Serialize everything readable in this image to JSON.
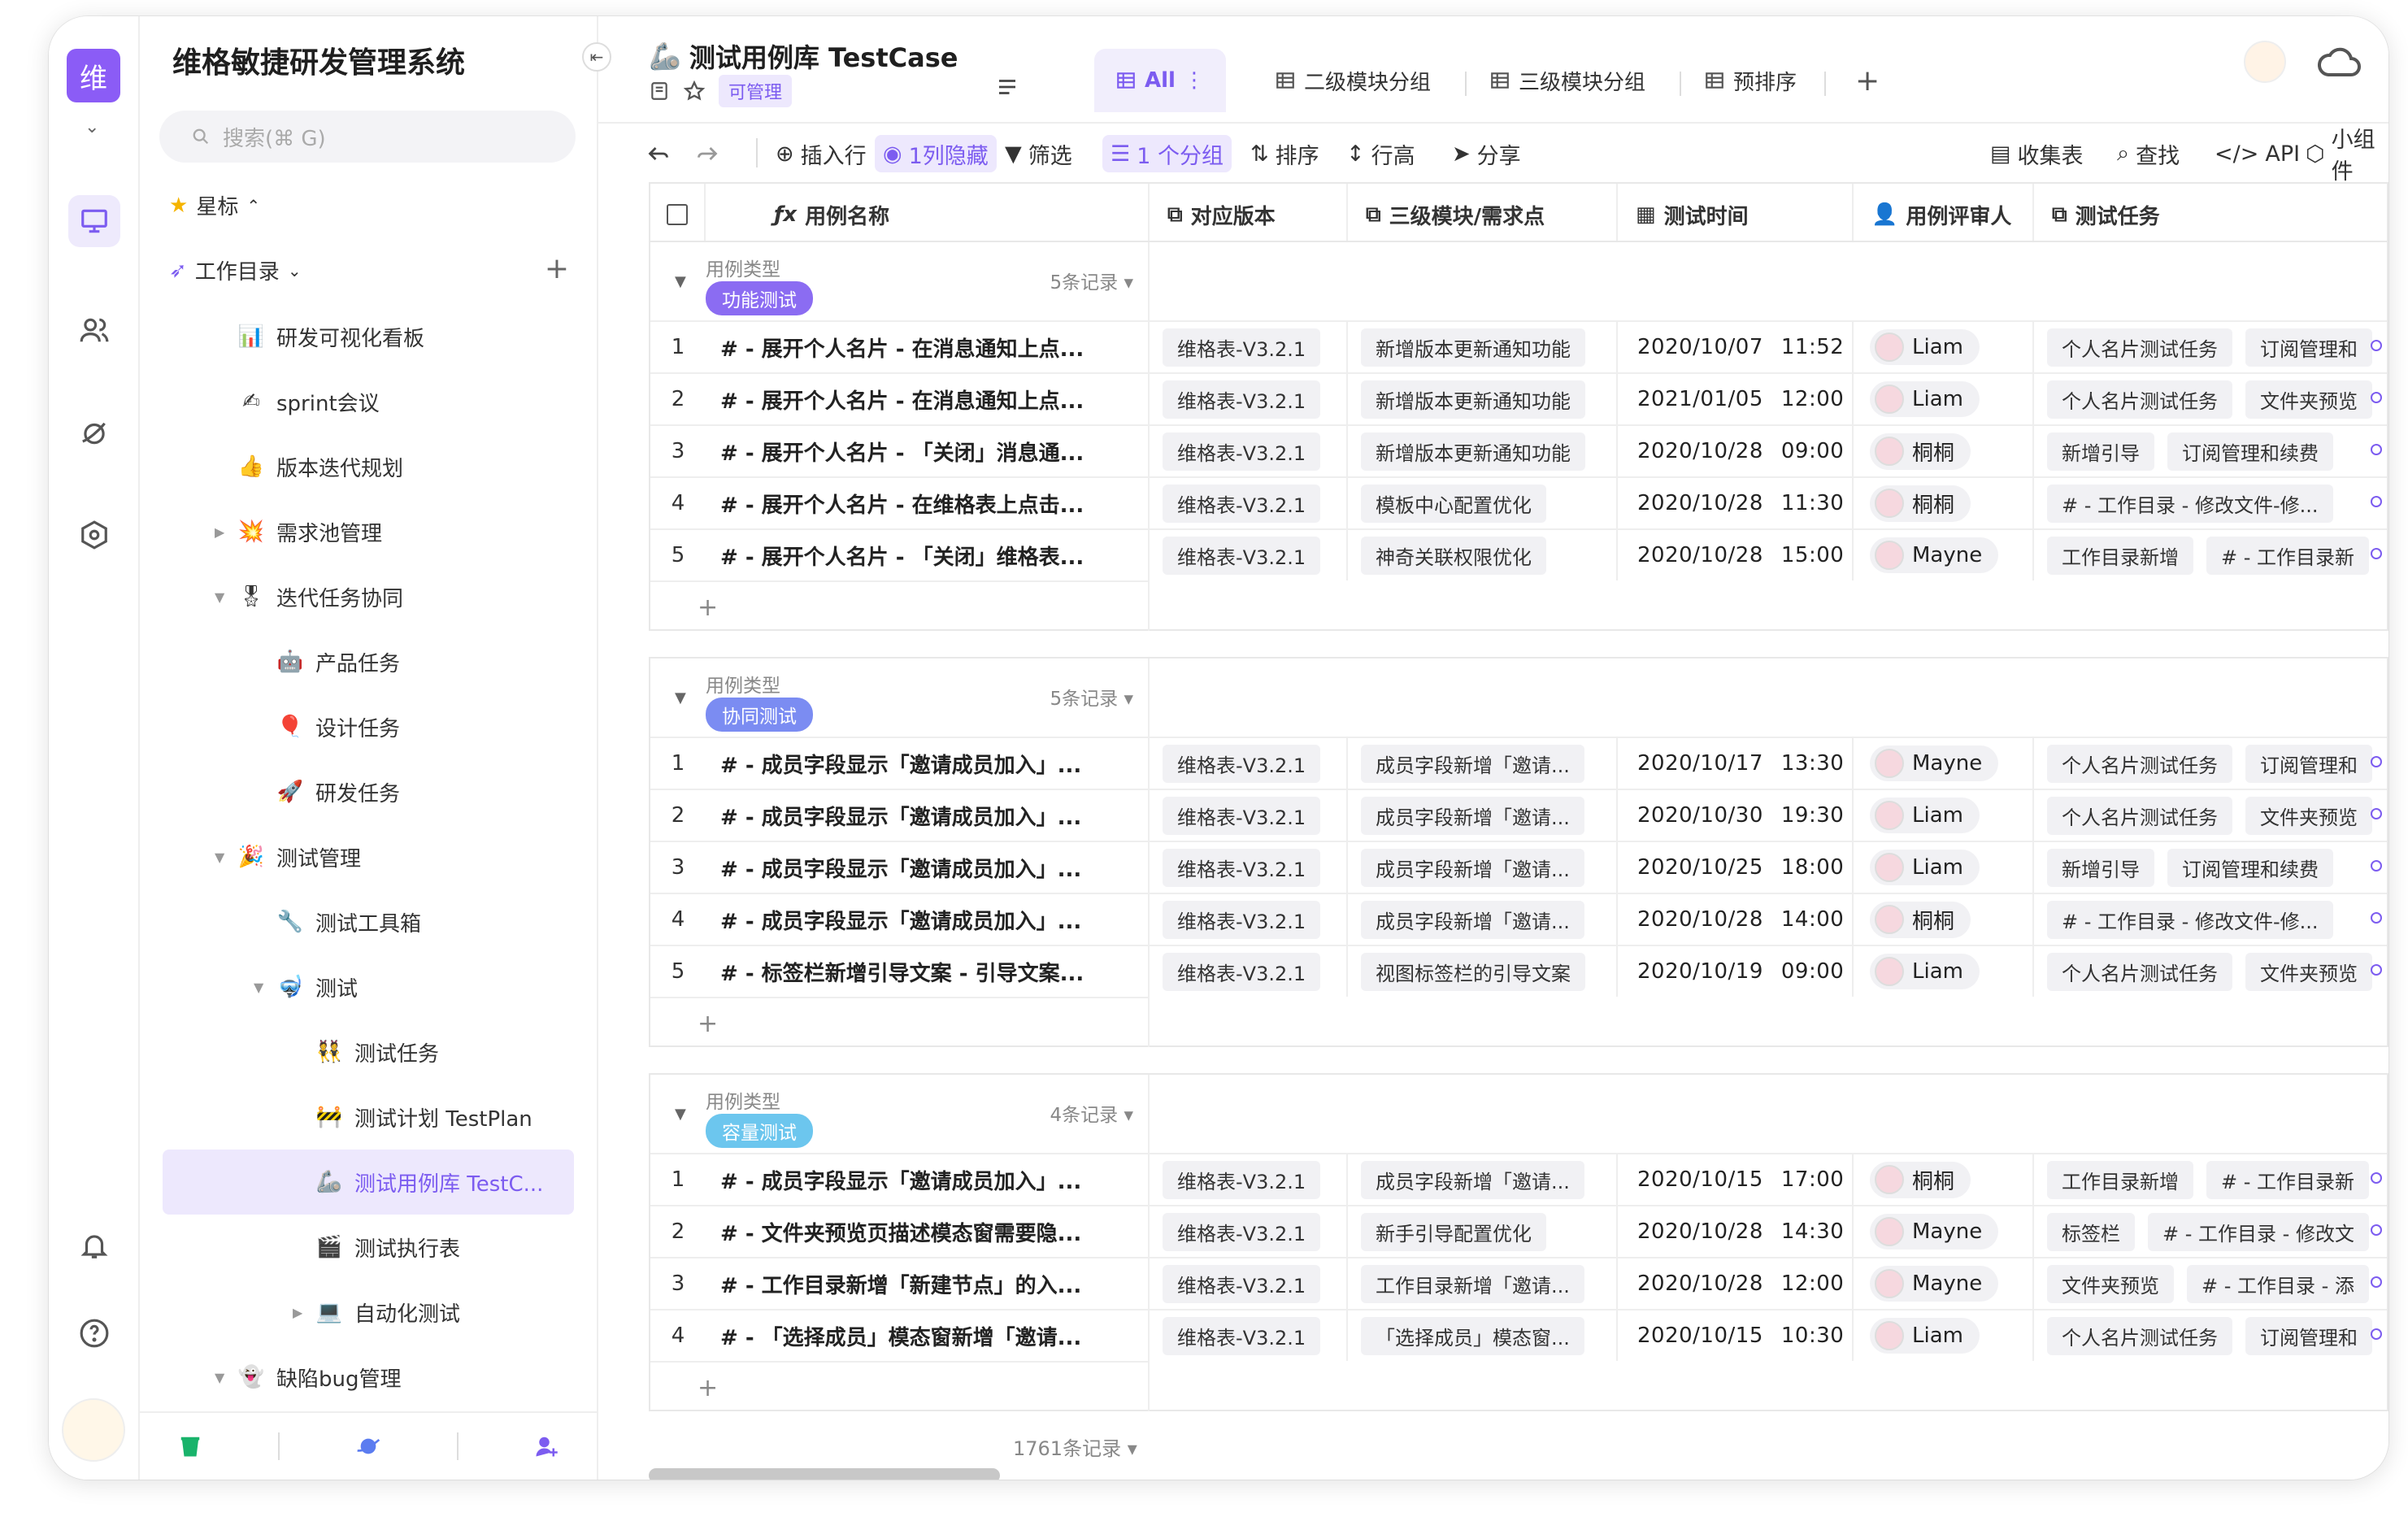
{
  "app": {
    "logo_char": "维",
    "title": "维格敏捷研发管理系统"
  },
  "search": {
    "placeholder": "搜索(⌘ G)"
  },
  "sidebar": {
    "star_label": "星标",
    "dir_label": "工作目录",
    "items": [
      {
        "label": "研发可视化看板",
        "emoji": "📊"
      },
      {
        "label": "sprint会议",
        "emoji": "✍"
      },
      {
        "label": "版本迭代规划",
        "emoji": "👍"
      },
      {
        "label": "需求池管理",
        "emoji": "💥"
      },
      {
        "label": "迭代任务协同",
        "emoji": "🎖"
      },
      {
        "label": "产品任务",
        "emoji": "🤖"
      },
      {
        "label": "设计任务",
        "emoji": "🎈"
      },
      {
        "label": "研发任务",
        "emoji": "🚀"
      },
      {
        "label": "测试管理",
        "emoji": "🎉"
      },
      {
        "label": "测试工具箱",
        "emoji": "🔧"
      },
      {
        "label": "测试",
        "emoji": "🤿"
      },
      {
        "label": "测试任务",
        "emoji": "👯"
      },
      {
        "label": "测试计划 TestPlan",
        "emoji": "🚧"
      },
      {
        "label": "测试用例库 TestC...",
        "emoji": "🦾"
      },
      {
        "label": "测试执行表",
        "emoji": "🎬"
      },
      {
        "label": "自动化测试",
        "emoji": "💻"
      },
      {
        "label": "缺陷bug管理",
        "emoji": "👻"
      }
    ]
  },
  "doc": {
    "title": "测试用例库 TestCase",
    "permission": "可管理"
  },
  "tabs": [
    "All",
    "二级模块分组",
    "三级模块分组",
    "预排序"
  ],
  "toolbar": {
    "insert": "插入行",
    "hidden": "1列隐藏",
    "filter": "筛选",
    "group": "1 个分组",
    "sort": "排序",
    "row_height": "行高",
    "share": "分享",
    "form": "收集表",
    "find": "查找",
    "api": "API",
    "widget": "小组件"
  },
  "columns": [
    "用例名称",
    "对应版本",
    "三级模块/需求点",
    "测试时间",
    "用例评审人",
    "测试任务"
  ],
  "group_field_label": "用例类型",
  "groups": [
    {
      "tag": "功能测试",
      "tag_color": "#8b6cf2",
      "count": "5条记录",
      "rows": [
        {
          "i": "1",
          "name": "# - 展开个人名片 - 在消息通知上点...",
          "ver": "维格表-V3.2.1",
          "module": "新增版本更新通知功能",
          "date": "2020/10/07",
          "time": "11:52",
          "reviewer": "Liam",
          "tasks": [
            "个人名片测试任务",
            "订阅管理和"
          ]
        },
        {
          "i": "2",
          "name": "# - 展开个人名片 - 在消息通知上点...",
          "ver": "维格表-V3.2.1",
          "module": "新增版本更新通知功能",
          "date": "2021/01/05",
          "time": "12:00",
          "reviewer": "Liam",
          "tasks": [
            "个人名片测试任务",
            "文件夹预览"
          ]
        },
        {
          "i": "3",
          "name": "# - 展开个人名片 - 「关闭」消息通...",
          "ver": "维格表-V3.2.1",
          "module": "新增版本更新通知功能",
          "date": "2020/10/28",
          "time": "09:00",
          "reviewer": "桐桐",
          "tasks": [
            "新增引导",
            "订阅管理和续费"
          ]
        },
        {
          "i": "4",
          "name": "# - 展开个人名片 - 在维格表上点击...",
          "ver": "维格表-V3.2.1",
          "module": "模板中心配置优化",
          "date": "2020/10/28",
          "time": "11:30",
          "reviewer": "桐桐",
          "tasks": [
            "# - 工作目录 - 修改文件-修..."
          ]
        },
        {
          "i": "5",
          "name": "# - 展开个人名片 - 「关闭」维格表...",
          "ver": "维格表-V3.2.1",
          "module": "神奇关联权限优化",
          "date": "2020/10/28",
          "time": "15:00",
          "reviewer": "Mayne",
          "tasks": [
            "工作目录新增",
            "# - 工作目录新"
          ]
        }
      ]
    },
    {
      "tag": "协同测试",
      "tag_color": "#7b8cf2",
      "count": "5条记录",
      "rows": [
        {
          "i": "1",
          "name": "# - 成员字段显示「邀请成员加入」...",
          "ver": "维格表-V3.2.1",
          "module": "成员字段新增「邀请...",
          "date": "2020/10/17",
          "time": "13:30",
          "reviewer": "Mayne",
          "tasks": [
            "个人名片测试任务",
            "订阅管理和"
          ]
        },
        {
          "i": "2",
          "name": "# - 成员字段显示「邀请成员加入」...",
          "ver": "维格表-V3.2.1",
          "module": "成员字段新增「邀请...",
          "date": "2020/10/30",
          "time": "19:30",
          "reviewer": "Liam",
          "tasks": [
            "个人名片测试任务",
            "文件夹预览"
          ]
        },
        {
          "i": "3",
          "name": "# - 成员字段显示「邀请成员加入」...",
          "ver": "维格表-V3.2.1",
          "module": "成员字段新增「邀请...",
          "date": "2020/10/25",
          "time": "18:00",
          "reviewer": "Liam",
          "tasks": [
            "新增引导",
            "订阅管理和续费"
          ]
        },
        {
          "i": "4",
          "name": "# - 成员字段显示「邀请成员加入」...",
          "ver": "维格表-V3.2.1",
          "module": "成员字段新增「邀请...",
          "date": "2020/10/28",
          "time": "14:00",
          "reviewer": "桐桐",
          "tasks": [
            "# - 工作目录 - 修改文件-修..."
          ]
        },
        {
          "i": "5",
          "name": "# - 标签栏新增引导文案 - 引导文案...",
          "ver": "维格表-V3.2.1",
          "module": "视图标签栏的引导文案",
          "date": "2020/10/19",
          "time": "09:00",
          "reviewer": "Liam",
          "tasks": [
            "个人名片测试任务",
            "文件夹预览"
          ]
        }
      ]
    },
    {
      "tag": "容量测试",
      "tag_color": "#6cc6ee",
      "count": "4条记录",
      "rows": [
        {
          "i": "1",
          "name": "# - 成员字段显示「邀请成员加入」...",
          "ver": "维格表-V3.2.1",
          "module": "成员字段新增「邀请...",
          "date": "2020/10/15",
          "time": "17:00",
          "reviewer": "桐桐",
          "tasks": [
            "工作目录新增",
            "# - 工作目录新"
          ]
        },
        {
          "i": "2",
          "name": "# - 文件夹预览页描述模态窗需要隐...",
          "ver": "维格表-V3.2.1",
          "module": "新手引导配置优化",
          "date": "2020/10/28",
          "time": "14:30",
          "reviewer": "Mayne",
          "tasks": [
            "标签栏",
            "# - 工作目录 - 修改文"
          ]
        },
        {
          "i": "3",
          "name": "# - 工作目录新增「新建节点」的入...",
          "ver": "维格表-V3.2.1",
          "module": "工作目录新增「邀请...",
          "date": "2020/10/28",
          "time": "12:00",
          "reviewer": "Mayne",
          "tasks": [
            "文件夹预览",
            "# - 工作目录 - 添"
          ]
        },
        {
          "i": "4",
          "name": "# - 「选择成员」模态窗新增「邀请...",
          "ver": "维格表-V3.2.1",
          "module": "「选择成员」模态窗...",
          "date": "2020/10/15",
          "time": "10:30",
          "reviewer": "Liam",
          "tasks": [
            "个人名片测试任务",
            "订阅管理和"
          ]
        }
      ]
    }
  ],
  "footer": {
    "records": "1761条记录"
  },
  "colors": {
    "accent": "#7c5cf0",
    "accent_bg": "#ede8fd"
  }
}
